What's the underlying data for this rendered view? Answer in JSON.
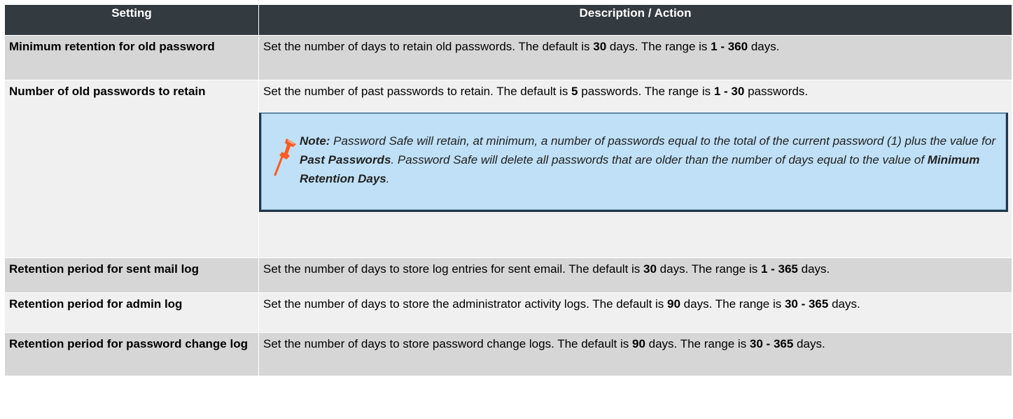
{
  "headers": {
    "setting": "Setting",
    "description": "Description / Action"
  },
  "rows": [
    {
      "setting": "Minimum retention for old password",
      "desc": [
        {
          "t": "Set the number of days to retain old passwords. The default is ",
          "b": false
        },
        {
          "t": "30",
          "b": true
        },
        {
          "t": " days. The range is ",
          "b": false
        },
        {
          "t": "1 - 360",
          "b": true
        },
        {
          "t": " days.",
          "b": false
        }
      ]
    },
    {
      "setting": "Number of old passwords to retain",
      "desc": [
        {
          "t": "Set the number of past passwords to retain. The default is ",
          "b": false
        },
        {
          "t": "5",
          "b": true
        },
        {
          "t": " passwords. The range is ",
          "b": false
        },
        {
          "t": "1 - 30",
          "b": true
        },
        {
          "t": " passwords.",
          "b": false
        }
      ],
      "note": [
        {
          "t": "Note:",
          "b": true
        },
        {
          "t": " Password Safe will retain, at minimum, a number of passwords equal to the total of the current password (1) plus the value for ",
          "b": false
        },
        {
          "t": "Past Passwords",
          "b": true
        },
        {
          "t": ". Password Safe will delete all passwords that are older than the number of days equal to the value of ",
          "b": false
        },
        {
          "t": "Minimum Retention Days",
          "b": true
        },
        {
          "t": ".",
          "b": false
        }
      ]
    },
    {
      "setting": "Retention period for sent mail log",
      "desc": [
        {
          "t": "Set the number of days to store log entries for sent email. The default is ",
          "b": false
        },
        {
          "t": "30",
          "b": true
        },
        {
          "t": " days. The range is ",
          "b": false
        },
        {
          "t": "1 - 365",
          "b": true
        },
        {
          "t": " days.",
          "b": false
        }
      ]
    },
    {
      "setting": "Retention period for admin log",
      "desc": [
        {
          "t": "Set the number of days to store the administrator activity logs. The default is ",
          "b": false
        },
        {
          "t": "90",
          "b": true
        },
        {
          "t": " days. The range is ",
          "b": false
        },
        {
          "t": "30 - 365",
          "b": true
        },
        {
          "t": " days.",
          "b": false
        }
      ]
    },
    {
      "setting": "Retention period for password change log",
      "desc": [
        {
          "t": "Set the number of days to store password change logs. The default is ",
          "b": false
        },
        {
          "t": "90",
          "b": true
        },
        {
          "t": " days. The range is ",
          "b": false
        },
        {
          "t": "30 - 365",
          "b": true
        },
        {
          "t": " days.",
          "b": false
        }
      ]
    }
  ],
  "icons": {
    "note": "pushpin-icon"
  },
  "colors": {
    "header_bg": "#333a40",
    "row_light": "#f0f0f0",
    "row_dark": "#d6d6d6",
    "note_bg": "#bfe0f6",
    "note_border": "#21364a",
    "pin": "#ff5a1f"
  }
}
